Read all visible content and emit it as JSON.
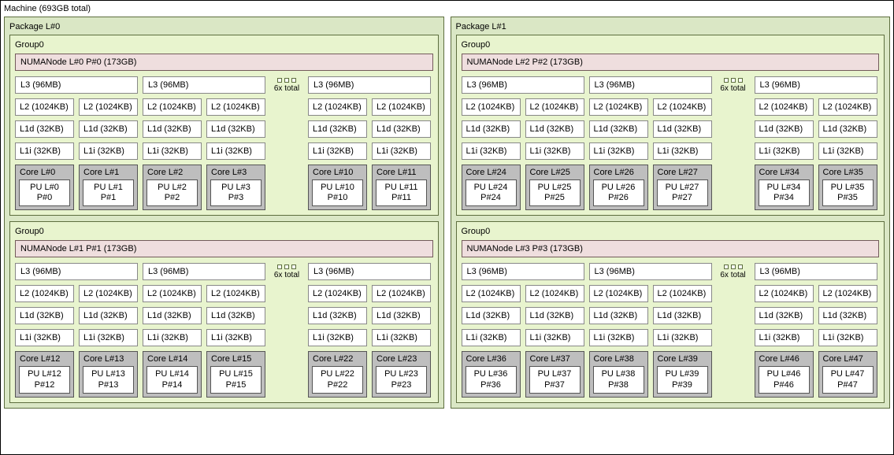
{
  "machine_title": "Machine (693GB total)",
  "mult_label": "6x total",
  "packages": [
    {
      "title": "Package L#0",
      "groups": [
        {
          "title": "Group0",
          "numa": "NUMANode L#0 P#0 (173GB)",
          "l3": [
            "L3 (96MB)",
            "L3 (96MB)",
            "L3 (96MB)"
          ],
          "l2": "L2 (1024KB)",
          "l1d": "L1d (32KB)",
          "l1i": "L1i (32KB)",
          "cores": [
            {
              "c": "Core L#0",
              "pu": "PU L#0",
              "p": "P#0"
            },
            {
              "c": "Core L#1",
              "pu": "PU L#1",
              "p": "P#1"
            },
            {
              "c": "Core L#2",
              "pu": "PU L#2",
              "p": "P#2"
            },
            {
              "c": "Core L#3",
              "pu": "PU L#3",
              "p": "P#3"
            },
            {
              "c": "Core L#10",
              "pu": "PU L#10",
              "p": "P#10"
            },
            {
              "c": "Core L#11",
              "pu": "PU L#11",
              "p": "P#11"
            }
          ]
        },
        {
          "title": "Group0",
          "numa": "NUMANode L#1 P#1 (173GB)",
          "l3": [
            "L3 (96MB)",
            "L3 (96MB)",
            "L3 (96MB)"
          ],
          "l2": "L2 (1024KB)",
          "l1d": "L1d (32KB)",
          "l1i": "L1i (32KB)",
          "cores": [
            {
              "c": "Core L#12",
              "pu": "PU L#12",
              "p": "P#12"
            },
            {
              "c": "Core L#13",
              "pu": "PU L#13",
              "p": "P#13"
            },
            {
              "c": "Core L#14",
              "pu": "PU L#14",
              "p": "P#14"
            },
            {
              "c": "Core L#15",
              "pu": "PU L#15",
              "p": "P#15"
            },
            {
              "c": "Core L#22",
              "pu": "PU L#22",
              "p": "P#22"
            },
            {
              "c": "Core L#23",
              "pu": "PU L#23",
              "p": "P#23"
            }
          ]
        }
      ]
    },
    {
      "title": "Package L#1",
      "groups": [
        {
          "title": "Group0",
          "numa": "NUMANode L#2 P#2 (173GB)",
          "l3": [
            "L3 (96MB)",
            "L3 (96MB)",
            "L3 (96MB)"
          ],
          "l2": "L2 (1024KB)",
          "l1d": "L1d (32KB)",
          "l1i": "L1i (32KB)",
          "cores": [
            {
              "c": "Core L#24",
              "pu": "PU L#24",
              "p": "P#24"
            },
            {
              "c": "Core L#25",
              "pu": "PU L#25",
              "p": "P#25"
            },
            {
              "c": "Core L#26",
              "pu": "PU L#26",
              "p": "P#26"
            },
            {
              "c": "Core L#27",
              "pu": "PU L#27",
              "p": "P#27"
            },
            {
              "c": "Core L#34",
              "pu": "PU L#34",
              "p": "P#34"
            },
            {
              "c": "Core L#35",
              "pu": "PU L#35",
              "p": "P#35"
            }
          ]
        },
        {
          "title": "Group0",
          "numa": "NUMANode L#3 P#3 (173GB)",
          "l3": [
            "L3 (96MB)",
            "L3 (96MB)",
            "L3 (96MB)"
          ],
          "l2": "L2 (1024KB)",
          "l1d": "L1d (32KB)",
          "l1i": "L1i (32KB)",
          "cores": [
            {
              "c": "Core L#36",
              "pu": "PU L#36",
              "p": "P#36"
            },
            {
              "c": "Core L#37",
              "pu": "PU L#37",
              "p": "P#37"
            },
            {
              "c": "Core L#38",
              "pu": "PU L#38",
              "p": "P#38"
            },
            {
              "c": "Core L#39",
              "pu": "PU L#39",
              "p": "P#39"
            },
            {
              "c": "Core L#46",
              "pu": "PU L#46",
              "p": "P#46"
            },
            {
              "c": "Core L#47",
              "pu": "PU L#47",
              "p": "P#47"
            }
          ]
        }
      ]
    }
  ]
}
